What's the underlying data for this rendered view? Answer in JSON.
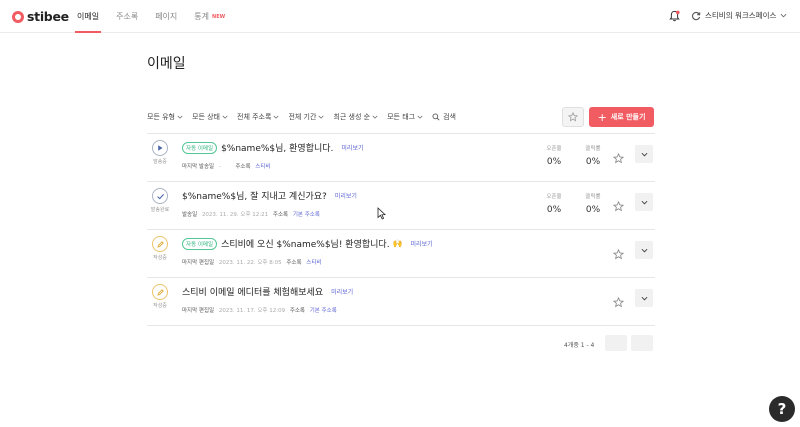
{
  "logo": {
    "text": "stibee"
  },
  "nav": {
    "items": [
      {
        "label": "이메일"
      },
      {
        "label": "주소록"
      },
      {
        "label": "페이지"
      },
      {
        "label": "통계"
      }
    ],
    "new_badge": "NEW"
  },
  "workspace": {
    "name": "스티비의 워크스페이스"
  },
  "page": {
    "title": "이메일"
  },
  "filters": {
    "type": "모든 유형",
    "status": "모든 상태",
    "address_book": "전체 주소록",
    "period": "전체 기간",
    "sort": "최근 생성 순",
    "tags": "모든 태그",
    "search": "검색"
  },
  "actions": {
    "new_button": "새로 만들기"
  },
  "columns": {
    "open_rate": "오픈율",
    "click_rate": "클릭률"
  },
  "emails": [
    {
      "status": "발송중",
      "auto_tag": "자동 이메일",
      "title": "$%name%$님, 환영합니다.",
      "emoji": "",
      "preview": "미리보기",
      "date_label": "마지막 발송일",
      "date": "-",
      "address_label": "주소록",
      "address_book": "스티비",
      "open_rate": "0%",
      "click_rate": "0%"
    },
    {
      "status": "발송완료",
      "auto_tag": "",
      "title": "$%name%$님, 잘 지내고 계신가요?",
      "emoji": "",
      "preview": "미리보기",
      "date_label": "발송일",
      "date": "2023. 11. 29. 오후 12:21",
      "address_label": "주소록",
      "address_book": "기본 주소록",
      "open_rate": "0%",
      "click_rate": "0%"
    },
    {
      "status": "작성중",
      "auto_tag": "자동 이메일",
      "title": "스티비에 오신 $%name%$님! 환영합니다.",
      "emoji": "🙌",
      "preview": "미리보기",
      "date_label": "마지막 편집일",
      "date": "2023. 11. 22. 오후 8:05",
      "address_label": "주소록",
      "address_book": "스티비",
      "open_rate": "",
      "click_rate": ""
    },
    {
      "status": "작성중",
      "auto_tag": "",
      "title": "스티비 이메일 에디터를 체험해보세요",
      "emoji": "",
      "preview": "미리보기",
      "date_label": "마지막 편집일",
      "date": "2023. 11. 17. 오후 12:09",
      "address_label": "주소록",
      "address_book": "기본 주소록",
      "open_rate": "",
      "click_rate": ""
    }
  ],
  "pagination": {
    "summary": "4개중 1 - 4"
  },
  "help": {
    "label": "?"
  },
  "colors": {
    "accent": "#f15c63",
    "link": "#5b64d4",
    "auto_tag": "#2db47d"
  }
}
